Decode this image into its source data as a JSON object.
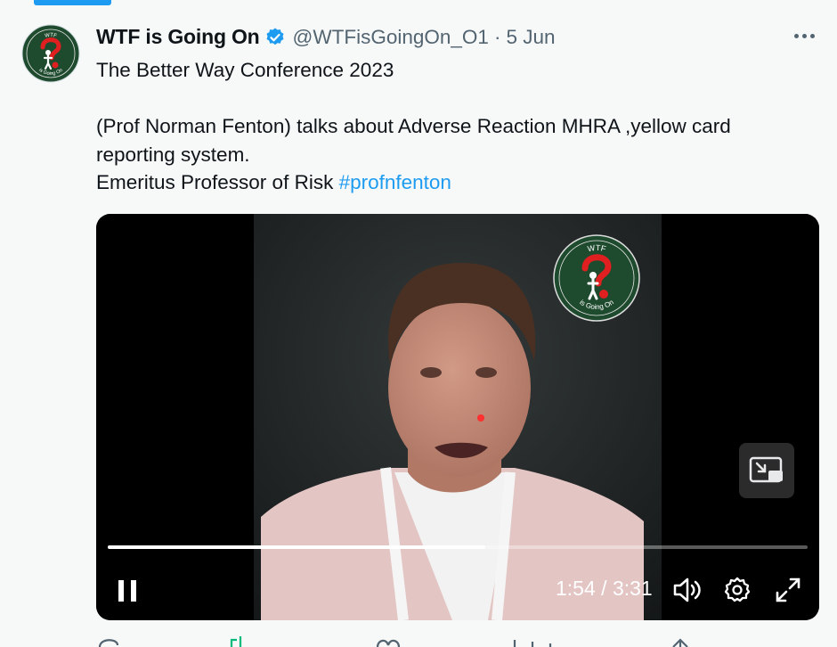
{
  "tweet": {
    "display_name": "WTF is Going On",
    "handle": "@WTFisGoingOn_O1",
    "separator": "·",
    "date": "5 Jun",
    "text_lines": [
      "The Better Way Conference 2023",
      "(Prof Norman Fenton) talks about Adverse Reaction MHRA ,yellow card",
      "reporting system.",
      "Emeritus Professor of Risk"
    ],
    "hashtag": "#profnfenton",
    "avatar": {
      "top_text": "WTF",
      "bottom_text": "is Going On"
    },
    "icons": [
      "verified-badge-icon",
      "more-options-icon"
    ]
  },
  "video": {
    "current_time": "1:54",
    "time_separator": "/",
    "duration": "3:31",
    "progress": 0.54,
    "watermark": {
      "top_text": "WTF",
      "bottom_text": "is Going On"
    },
    "icons": [
      "pause-icon",
      "volume-icon",
      "settings-icon",
      "fullscreen-icon",
      "picture-in-picture-icon"
    ]
  },
  "colors": {
    "accent": "#1d9bf0",
    "text": "#0f1419",
    "muted": "#536471",
    "background": "#f7f9f9",
    "logo_green": "#1e4a2e",
    "logo_red": "#e02020"
  }
}
